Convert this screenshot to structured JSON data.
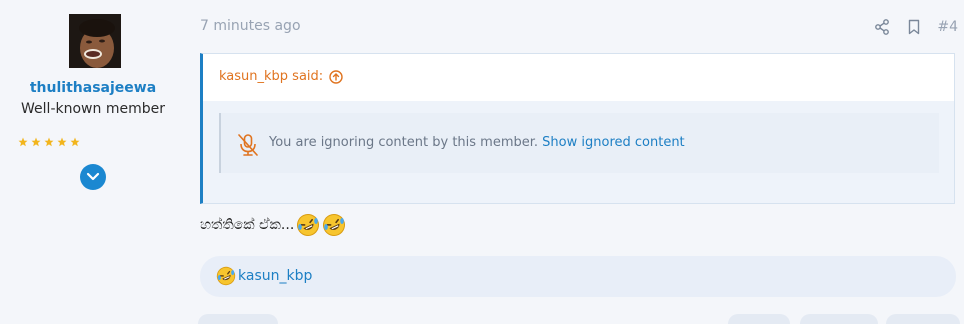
{
  "user": {
    "name": "thulithasajeewa",
    "title": "Well-known member",
    "star_count": 5,
    "star_color": "#f2b51d"
  },
  "post": {
    "time": "7 minutes ago",
    "number": "#4"
  },
  "quote": {
    "author_said": "kasun_kbp said:",
    "ignored_text": "You are ignoring content by this member.",
    "show_ignored_label": "Show ignored content"
  },
  "message": {
    "text": "හත්තිකේ ඒක...",
    "emoji": [
      "rolling-on-floor-laughing",
      "rolling-on-floor-laughing"
    ]
  },
  "reactions": {
    "emoji": "rolling-on-floor-laughing",
    "user": "kasun_kbp"
  },
  "colors": {
    "accent": "#1d7fc4",
    "quote_author": "#e07420",
    "muted": "#98a3b3"
  },
  "icons": {
    "share": "share-icon",
    "bookmark": "bookmark-icon",
    "quote_up": "arrow-up-circle-icon",
    "ignored": "muted-microphone-icon",
    "expand": "chevron-down-icon"
  }
}
